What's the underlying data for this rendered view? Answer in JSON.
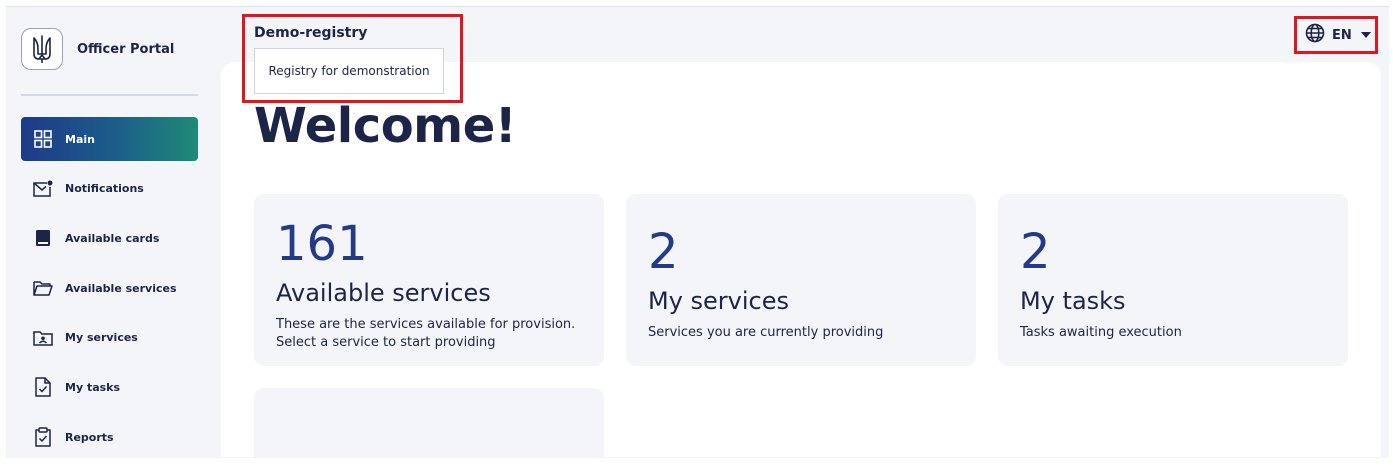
{
  "app": {
    "title": "Officer Portal"
  },
  "sidebar": {
    "items": [
      {
        "label": "Main",
        "icon": "grid-icon",
        "active": true
      },
      {
        "label": "Notifications",
        "icon": "envelope-notification-icon",
        "active": false
      },
      {
        "label": "Available cards",
        "icon": "card-icon",
        "active": false
      },
      {
        "label": "Available services",
        "icon": "folder-icon",
        "active": false
      },
      {
        "label": "My services",
        "icon": "user-folder-icon",
        "active": false
      },
      {
        "label": "My tasks",
        "icon": "task-document-icon",
        "active": false
      },
      {
        "label": "Reports",
        "icon": "clipboard-check-icon",
        "active": false
      }
    ]
  },
  "header": {
    "registry_name": "Demo-registry",
    "registry_description": "Registry for demonstration",
    "language": "EN"
  },
  "main": {
    "welcome": "Welcome!",
    "cards": [
      {
        "count": "161",
        "title": "Available services",
        "desc_line1": "These are the services available for provision.",
        "desc_line2": "Select a service to start providing"
      },
      {
        "count": "2",
        "title": "My services",
        "desc_line1": "Services you are currently providing"
      },
      {
        "count": "2",
        "title": "My tasks",
        "desc_line1": "Tasks awaiting execution"
      }
    ]
  },
  "colors": {
    "accent_gradient_start": "#1e3a8a",
    "accent_gradient_end": "#1f8a75",
    "highlight_border": "#e0161e",
    "count_color": "#253a86",
    "text_primary": "#1c2447"
  }
}
